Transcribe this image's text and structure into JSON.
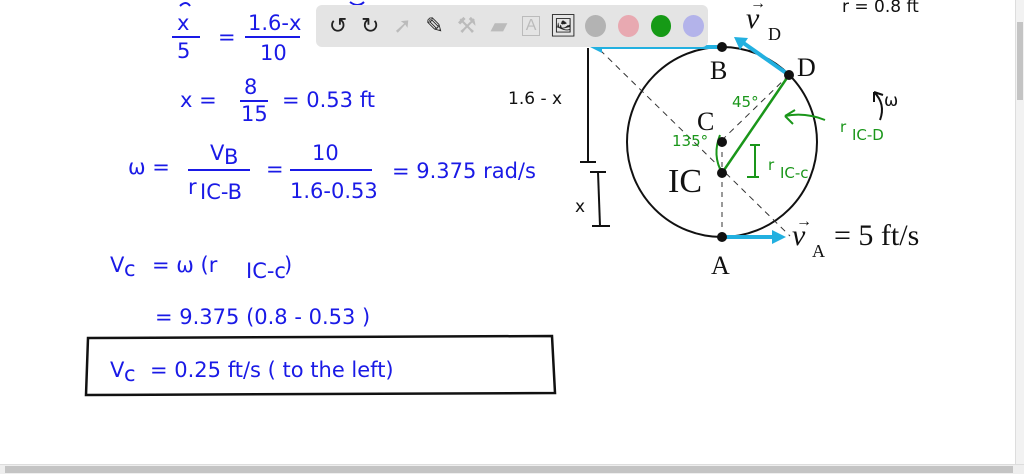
{
  "toolbar": {
    "tools": [
      "undo-icon",
      "redo-icon",
      "pointer-icon",
      "pencil-icon",
      "tools-icon",
      "eraser-icon",
      "text-icon",
      "image-icon"
    ],
    "colors": [
      "#b3b3b3",
      "#e8a9b1",
      "#169a16",
      "#b3b3ea"
    ]
  },
  "work": {
    "eq1_lhs_num": "x",
    "eq1_lhs_den": "5",
    "eq1_eq": "=",
    "eq1_rhs_num": "1.6-x",
    "eq1_rhs_den": "10",
    "eq2": "x =",
    "eq2_num": "8",
    "eq2_den": "15",
    "eq2_result": "= 0.53 ft",
    "omega": "ω =",
    "omega_num1": "V",
    "omega_num1_sub": "B",
    "omega_den1": "r",
    "omega_den1_sub": "IC-B",
    "omega_eq2": "=",
    "omega_num2": "10",
    "omega_den2": "1.6-0.53",
    "omega_result": "= 9.375 rad/s",
    "vc_line1": "V",
    "vc_line1_sub": "c",
    "vc_line1_rest": "= ω (r",
    "vc_line1_sub2": "IC-c",
    "vc_line1_close": ")",
    "vc_line2": "= 9.375 (0.8 - 0.53 )",
    "answer": "V",
    "answer_sub": "c",
    "answer_rest": "= 0.25 ft/s  ( to the left)"
  },
  "diagram": {
    "radius_label": "r = 0.8 ft",
    "dim_upper": "1.6 - x",
    "dim_lower": "x",
    "point_b": "B",
    "point_d": "D",
    "point_c": "C",
    "point_ic": "IC",
    "point_a": "A",
    "vd_label": "v",
    "vd_sub": "D",
    "va_label": "v",
    "va_sub": "A",
    "va_value": "= 5 ft/s",
    "angle_45": "45°",
    "angle_135": "135°",
    "r_ic_d": "r",
    "r_ic_d_sub": "IC-D",
    "r_ic_c": "r",
    "r_ic_c_sub": "IC-c",
    "omega": "ω"
  }
}
